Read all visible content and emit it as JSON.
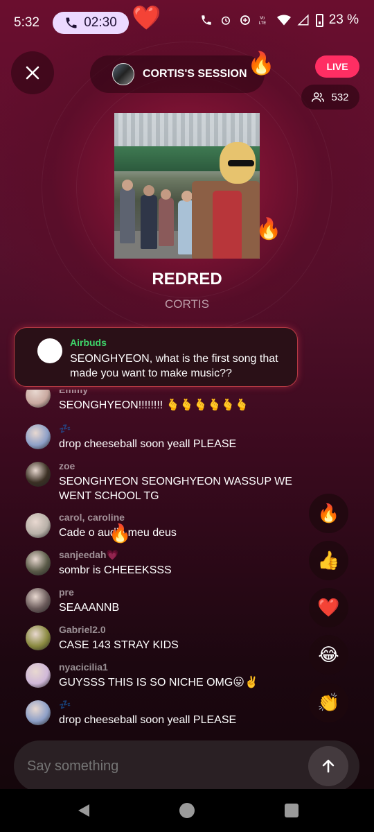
{
  "status_bar": {
    "time": "5:32",
    "call_timer": "02:30",
    "heart_emoji": "❤️",
    "battery_text": "23 %"
  },
  "header": {
    "session_title": "CORTIS'S SESSION",
    "session_fire": "🔥",
    "live_label": "LIVE",
    "viewer_count": "532"
  },
  "now_playing": {
    "title": "REDRED",
    "artist": "CORTIS",
    "fire": "🔥"
  },
  "pinned_question": {
    "name": "Airbuds",
    "text": "SEONGHYEON, what is the first song that made you want to make music??"
  },
  "chat": [
    {
      "name": "Emmy",
      "text": "SEONGHYEON!!!!!!!! 🫰🫰🫰🫰🫰🫰",
      "avatar_color": "#c9a9a0"
    },
    {
      "name": "💤",
      "text": "drop cheeseball soon yeall PLEASE",
      "avatar_color": "#8ea0c8"
    },
    {
      "name": "zoe",
      "text": "SEONGHYEON SEONGHYEON WASSUP WE WENT SCHOOL TG",
      "avatar_color": "#3b3024"
    },
    {
      "name": "carol, caroline",
      "text": "Cade o audio meu deus",
      "avatar_color": "#b8b0a8"
    },
    {
      "name": "sanjeedah💗",
      "text": "sombr is CHEEEKSSS",
      "avatar_color": "#5a5a48"
    },
    {
      "name": "pre",
      "text": "SEAAANNB",
      "avatar_color": "#6a5a5a"
    },
    {
      "name": "Gabriel2.0",
      "text": "CASE 143 STRAY KIDS",
      "avatar_color": "#8a8a40"
    },
    {
      "name": "nyacicilia1",
      "text": "GUYSSS THIS IS SO NICHE OMG😛✌️",
      "avatar_color": "#d0b8d8"
    },
    {
      "name": "💤",
      "text": "drop cheeseball soon yeall PLEASE",
      "avatar_color": "#8ea0c8"
    }
  ],
  "chat_overlay_fire": "🔥",
  "reactions": [
    {
      "emoji": "🔥",
      "name": "fire"
    },
    {
      "emoji": "👍",
      "name": "thumbs-up"
    },
    {
      "emoji": "❤️",
      "name": "heart"
    },
    {
      "emoji": "😂",
      "name": "laughing"
    },
    {
      "emoji": "👏",
      "name": "clapping"
    }
  ],
  "input": {
    "placeholder": "Say something"
  },
  "colors": {
    "live_badge": "#ff2e63",
    "question_name": "#3ed46a",
    "question_border": "#dc4650"
  }
}
